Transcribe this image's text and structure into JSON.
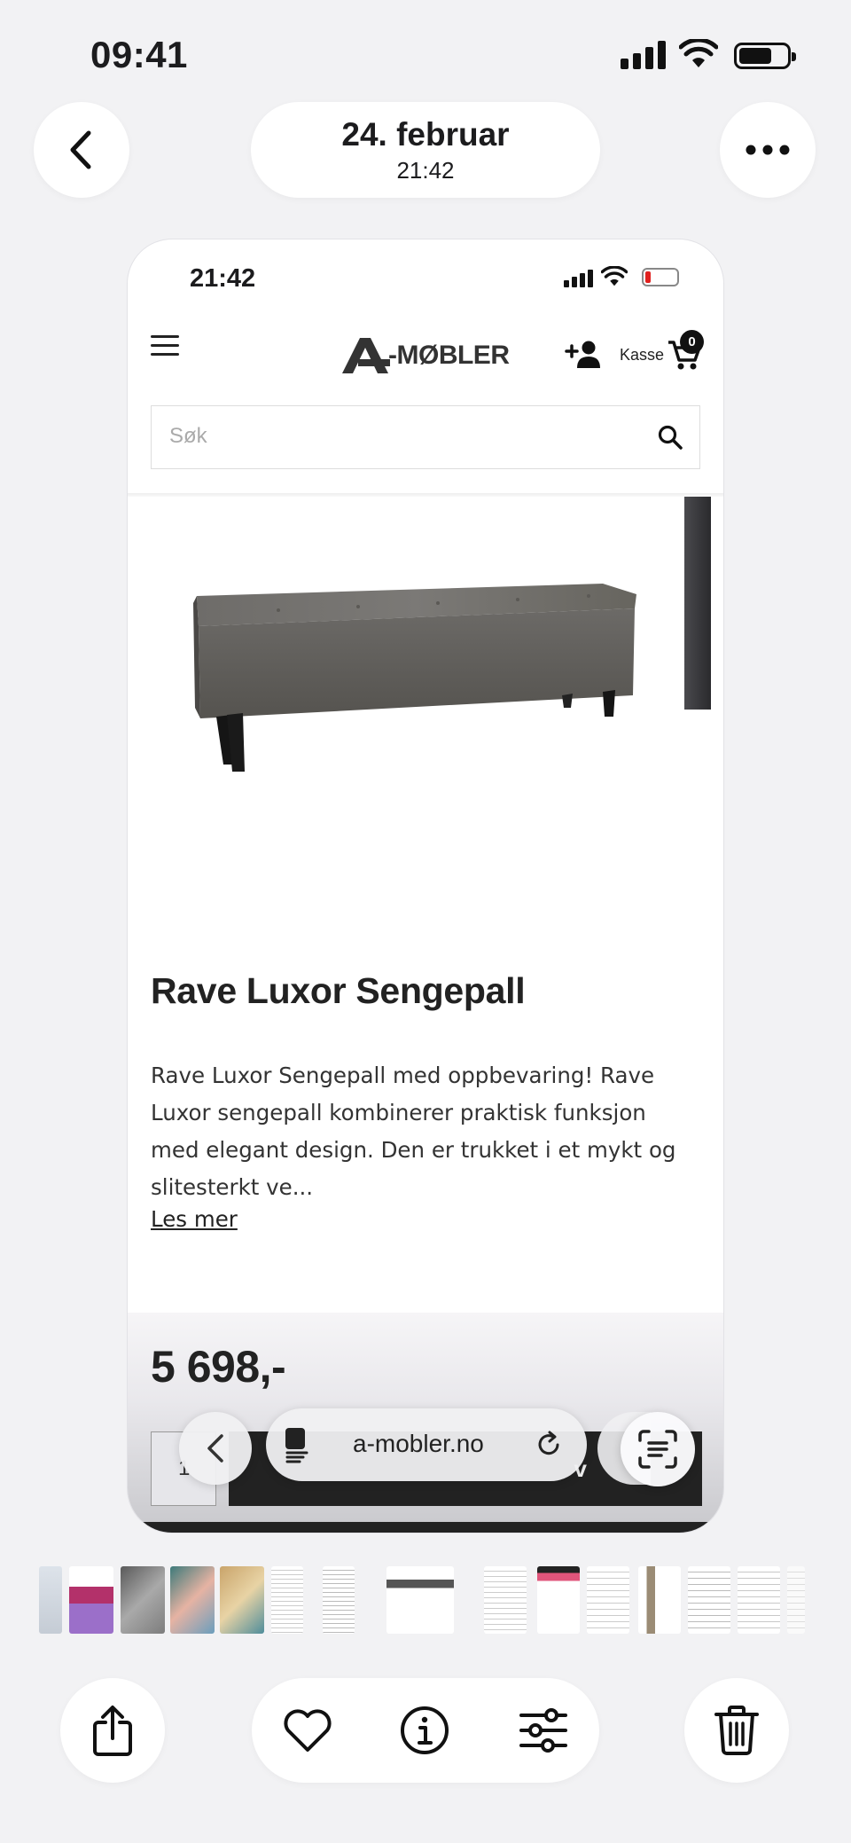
{
  "status_bar": {
    "time": "09:41"
  },
  "header": {
    "date": "24. februar",
    "time": "21:42"
  },
  "screenshot": {
    "status_time": "21:42",
    "site": {
      "logo_text": "-MØBLER",
      "cart_label": "Kasse",
      "cart_count": "0",
      "search_placeholder": "Søk"
    },
    "product": {
      "title": "Rave Luxor Sengepall",
      "description": "Rave Luxor Sengepall med oppbevaring! Rave Luxor sengepall kombinerer praktisk funksjon med elegant design. Den er trukket i et mykt og slitesterkt ve...",
      "read_more": "Les mer",
      "price": "5 698,-",
      "quantity": "1",
      "add_button_partial": "v"
    },
    "browser": {
      "domain": "a-mobler.no"
    }
  },
  "colors": {
    "background": "#f2f2f4",
    "dark": "#222222",
    "battery_low": "#e0201e"
  },
  "icons": [
    "back-chevron",
    "more",
    "menu",
    "add-user",
    "cart",
    "search",
    "reader",
    "reload",
    "scan-text",
    "share",
    "heart",
    "info",
    "adjust",
    "trash"
  ]
}
